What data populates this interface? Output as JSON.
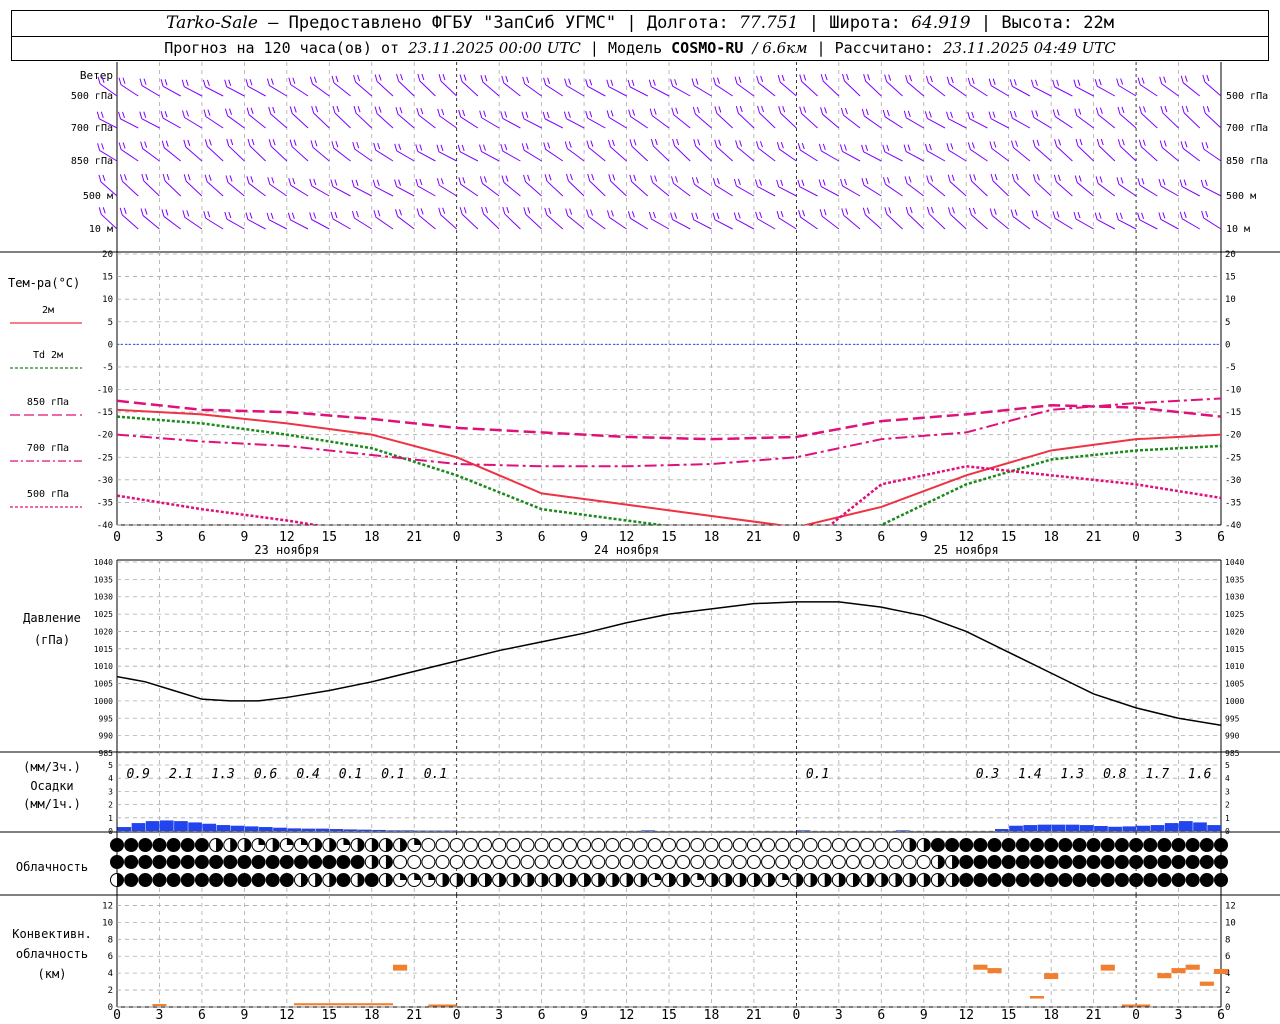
{
  "header": {
    "location": "Tarko-Sale",
    "dash": "–",
    "provider": "Предоставлено ФГБУ \"ЗапСиб УГМС\"",
    "lon_label": "Долгота:",
    "lon": "77.751",
    "lat_label": "Широта:",
    "lat": "64.919",
    "alt_label": "Высота:",
    "alt": "22м",
    "forecast_label": "Прогноз на 120 часа(ов) от",
    "forecast_start": "23.11.2025 00:00 UTC",
    "model_label": "Модель",
    "model": "COSMO-RU",
    "resolution": "/ 6.6км",
    "calc_label": "Рассчитано:",
    "calc_time": "23.11.2025 04:49 UTC"
  },
  "colors": {
    "wind": "#8000ff",
    "t2m": "#ee3344",
    "td2m": "#1a8a1a",
    "upper": "#e0107a",
    "pressure": "#000000",
    "precip": "#2244ee",
    "convective": "#f08030",
    "zero_line": "#2255ff",
    "grid": "#aaaaaa"
  },
  "chart_data": [
    {
      "type": "line",
      "title": "Ветер",
      "levels": [
        "500 гПа",
        "700 гПа",
        "850 гПа",
        "500 м",
        "10 м"
      ],
      "symbol": "wind barbs"
    },
    {
      "type": "line",
      "title": "Тем-ра(°C)",
      "x_ticks": [
        "0",
        "3",
        "6",
        "9",
        "12",
        "15",
        "18",
        "21",
        "0",
        "3",
        "6",
        "9",
        "12",
        "15",
        "18",
        "21",
        "0",
        "3",
        "6",
        "9",
        "12",
        "15",
        "18",
        "21",
        "0",
        "3",
        "6"
      ],
      "day_labels": [
        "23 ноября",
        "24 ноября",
        "25 ноября"
      ],
      "y_ticks": [
        "20",
        "15",
        "10",
        "5",
        "0",
        "-5",
        "-10",
        "-15",
        "-20",
        "-25",
        "-30",
        "-35",
        "-40"
      ],
      "ylim": [
        -40,
        20
      ],
      "x": [
        0,
        6,
        12,
        18,
        24,
        30,
        36,
        42,
        48,
        54,
        60,
        66,
        72,
        78
      ],
      "series": [
        {
          "name": "2м",
          "values": [
            -14.5,
            -15.5,
            -17.5,
            -20,
            -25,
            -33,
            -35.5,
            -38,
            -40.5,
            -36,
            -29,
            -23.5,
            -21,
            -20
          ]
        },
        {
          "name": "Td 2м",
          "values": [
            -16,
            -17.5,
            -20,
            -23,
            -29,
            -36.5,
            -39,
            -41.5,
            -45,
            -40,
            -31,
            -25.5,
            -23.5,
            -22.5
          ]
        },
        {
          "name": "850 гПа",
          "values": [
            -12.5,
            -14.5,
            -15,
            -16.5,
            -18.5,
            -19.5,
            -20.5,
            -21,
            -20.5,
            -17,
            -15.5,
            -13.5,
            -14,
            -16
          ]
        },
        {
          "name": "700 гПа",
          "values": [
            -20,
            -21.5,
            -22.5,
            -24.5,
            -26.5,
            -27,
            -27,
            -26.5,
            -25,
            -21,
            -19.5,
            -14.5,
            -13,
            -12
          ]
        },
        {
          "name": "500 гПа",
          "values": [
            -33.5,
            -36.5,
            -39,
            -42,
            -45,
            -47,
            -48,
            -48,
            -46,
            -31,
            -27,
            -29,
            -31,
            -34
          ]
        }
      ]
    },
    {
      "type": "line",
      "title": "Давление",
      "unit": "(гПа)",
      "y_ticks": [
        "1040",
        "1035",
        "1030",
        "1025",
        "1020",
        "1015",
        "1010",
        "1005",
        "1000",
        "995",
        "990",
        "985"
      ],
      "ylim": [
        985,
        1040
      ],
      "x": [
        0,
        2,
        4,
        6,
        8,
        10,
        12,
        15,
        18,
        21,
        24,
        27,
        30,
        33,
        36,
        39,
        42,
        45,
        48,
        51,
        54,
        57,
        60,
        63,
        66,
        69,
        72,
        75,
        78
      ],
      "series": [
        {
          "name": "Давление",
          "values": [
            1007,
            1005.5,
            1003,
            1000.5,
            1000,
            1000,
            1001,
            1003,
            1005.5,
            1008.5,
            1011.5,
            1014.5,
            1017,
            1019.5,
            1022.5,
            1025,
            1026.5,
            1028,
            1028.5,
            1028.5,
            1027,
            1024.5,
            1020,
            1014,
            1008,
            1002,
            998,
            995,
            993
          ]
        }
      ]
    },
    {
      "type": "bar",
      "title": "Осадки",
      "units": [
        "(мм/3ч.)",
        "(мм/1ч.)"
      ],
      "y_ticks": [
        "5",
        "4",
        "3",
        "2",
        "1",
        "0"
      ],
      "ylim": [
        0,
        5
      ],
      "labels_3h": [
        {
          "x": 1.5,
          "text": "0.9"
        },
        {
          "x": 4.5,
          "text": "2.1"
        },
        {
          "x": 7.5,
          "text": "1.3"
        },
        {
          "x": 10.5,
          "text": "0.6"
        },
        {
          "x": 13.5,
          "text": "0.4"
        },
        {
          "x": 16.5,
          "text": "0.1"
        },
        {
          "x": 19.5,
          "text": "0.1"
        },
        {
          "x": 22.5,
          "text": "0.1"
        },
        {
          "x": 49.5,
          "text": "0.1"
        },
        {
          "x": 61.5,
          "text": "0.3"
        },
        {
          "x": 64.5,
          "text": "1.4"
        },
        {
          "x": 67.5,
          "text": "1.3"
        },
        {
          "x": 70.5,
          "text": "0.8"
        },
        {
          "x": 73.5,
          "text": "1.7"
        },
        {
          "x": 76.5,
          "text": "1.6"
        }
      ],
      "x": [
        1,
        2,
        3,
        4,
        5,
        6,
        7,
        8,
        9,
        10,
        11,
        12,
        13,
        14,
        15,
        16,
        17,
        18,
        19,
        20,
        21,
        22,
        23,
        24,
        38,
        49,
        56,
        63,
        64,
        65,
        66,
        67,
        68,
        69,
        70,
        71,
        72,
        73,
        74,
        75,
        76,
        77,
        78
      ],
      "values": [
        0.3,
        0.6,
        0.75,
        0.8,
        0.75,
        0.65,
        0.55,
        0.45,
        0.4,
        0.35,
        0.3,
        0.25,
        0.2,
        0.18,
        0.18,
        0.15,
        0.12,
        0.1,
        0.08,
        0.05,
        0.05,
        0.03,
        0.03,
        0.03,
        0.05,
        0.05,
        0.05,
        0.15,
        0.4,
        0.45,
        0.48,
        0.48,
        0.48,
        0.45,
        0.38,
        0.32,
        0.35,
        0.4,
        0.45,
        0.6,
        0.75,
        0.65,
        0.45
      ]
    },
    {
      "type": "table",
      "title": "Облачность",
      "rows": [
        "FFFFFFFHHHQHQQHHQHHHHQOOOOOOOOOOOOOOOOOOOOOOOOOOOOOOOOOOHHFFFFFFFFFFFFFFFFFFFFFHHFOO",
        "FFFFFFFFFFFFFFFFFFHHOOOOOOOOOOOOOOOOOOOOOOOOOOOOOOOOOOOOOOHHFFFFFFFFFFFFFFFFFFFFFFFFFFF",
        "HFFFFFFFFFFFFHHHFHFHQQQHHHHHHHHHHHHHHHQHHQHHHHHQHHHHHHHHHHHHFFFFFFFFFFFFFFFFFFFFFFFFFFFF"
      ],
      "symbols": {
        "F": "overcast",
        "H": "half",
        "Q": "quarter",
        "O": "clear"
      }
    },
    {
      "type": "bar",
      "title": "Конвективн. облачность",
      "unit": "(км)",
      "y_ticks": [
        "12",
        "10",
        "8",
        "6",
        "4",
        "2",
        "0"
      ],
      "ylim": [
        0,
        13
      ],
      "segments": [
        {
          "x0": 2.5,
          "x1": 3.5,
          "base": 0.2,
          "top": 0.35
        },
        {
          "x0": 12.5,
          "x1": 19.5,
          "base": 0.2,
          "top": 0.45
        },
        {
          "x0": 19.5,
          "x1": 20.5,
          "base": 4.3,
          "top": 5
        },
        {
          "x0": 22,
          "x1": 24,
          "base": 0.15,
          "top": 0.3
        },
        {
          "x0": 60.5,
          "x1": 61.5,
          "base": 4.4,
          "top": 5
        },
        {
          "x0": 61.5,
          "x1": 62.5,
          "base": 4,
          "top": 4.6
        },
        {
          "x0": 64.5,
          "x1": 65.5,
          "base": 1,
          "top": 1.3
        },
        {
          "x0": 65.5,
          "x1": 66.5,
          "base": 3.3,
          "top": 4
        },
        {
          "x0": 69.5,
          "x1": 70.5,
          "base": 4.3,
          "top": 5
        },
        {
          "x0": 71,
          "x1": 73,
          "base": 0.15,
          "top": 0.3
        },
        {
          "x0": 73.5,
          "x1": 74.5,
          "base": 3.4,
          "top": 4
        },
        {
          "x0": 74.5,
          "x1": 75.5,
          "base": 4,
          "top": 4.6
        },
        {
          "x0": 75.5,
          "x1": 76.5,
          "base": 4.4,
          "top": 5
        },
        {
          "x0": 76.5,
          "x1": 77.5,
          "base": 2.5,
          "top": 3
        },
        {
          "x0": 77.5,
          "x1": 78.5,
          "base": 3.9,
          "top": 4.5
        }
      ]
    }
  ]
}
